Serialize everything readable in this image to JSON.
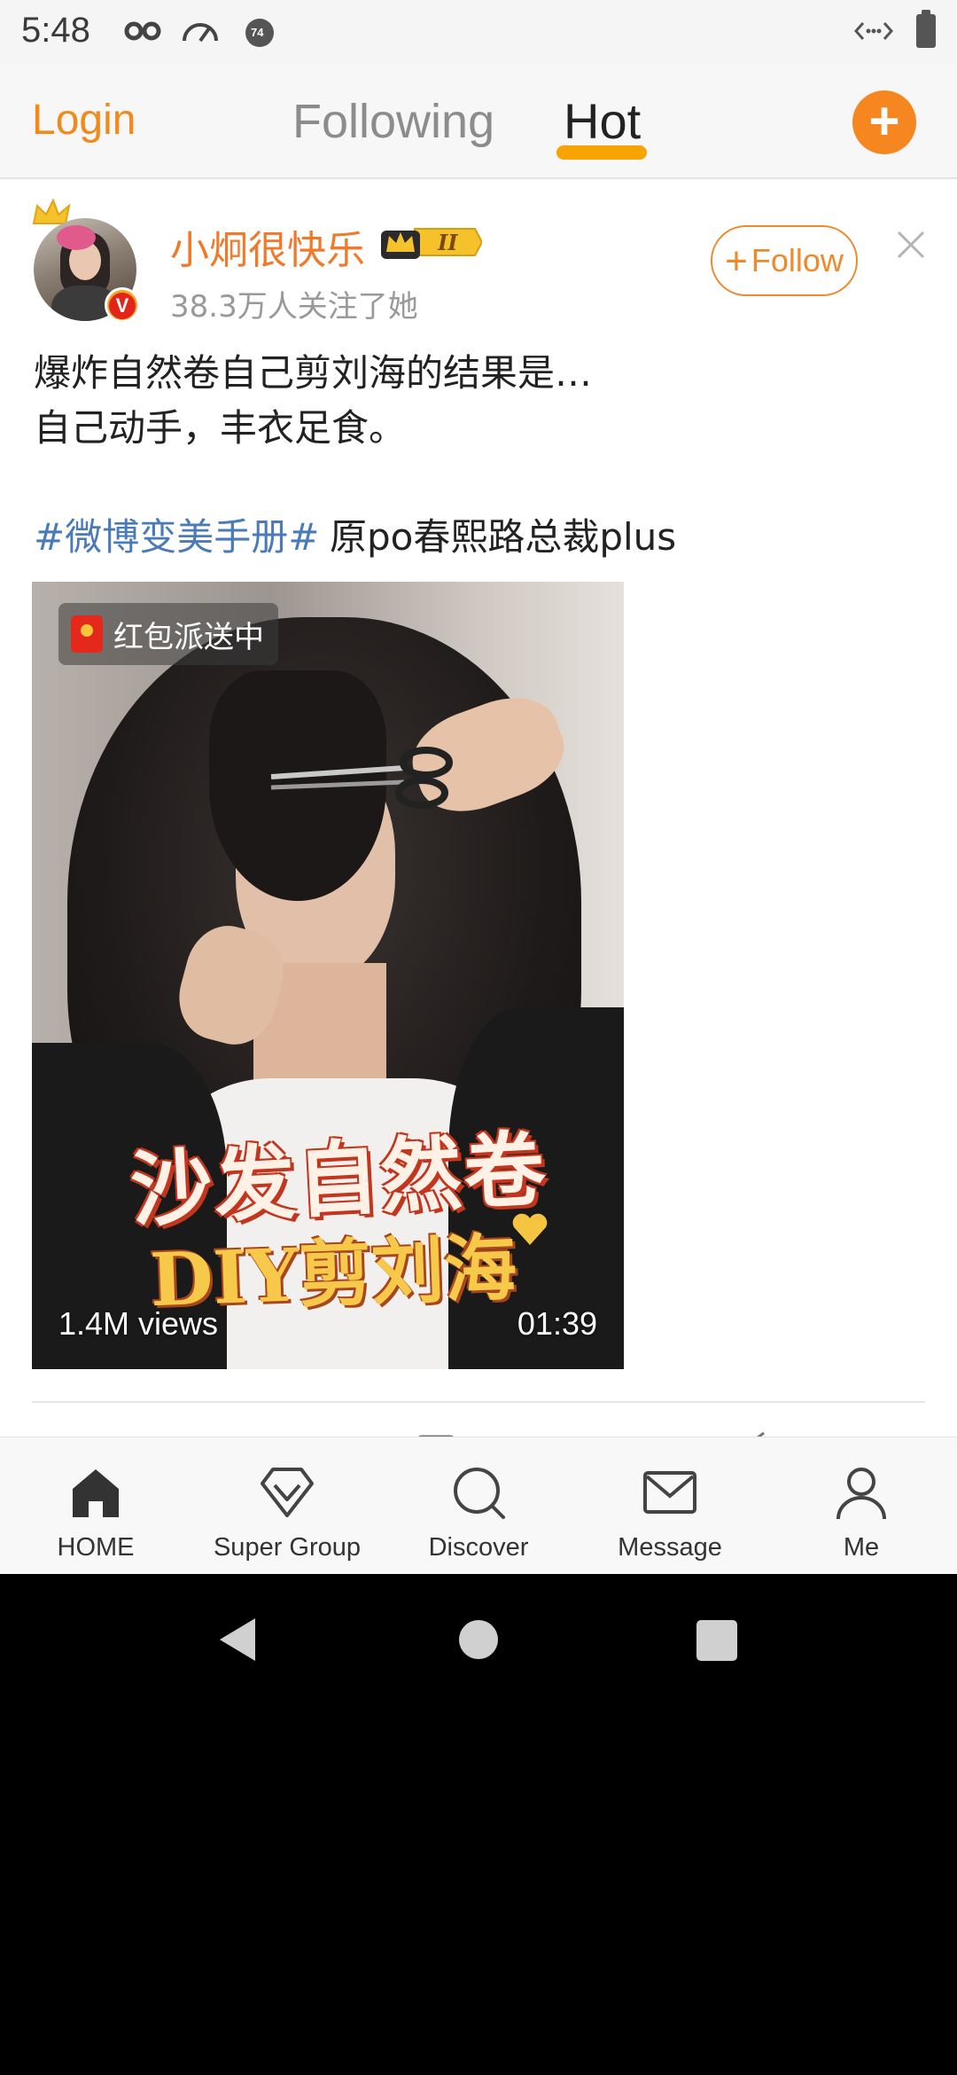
{
  "status_bar": {
    "time": "5:48",
    "icons": [
      "incognito-icon",
      "speedometer-icon",
      "notification-count-icon",
      "data-transfer-icon",
      "battery-icon"
    ],
    "notification_count": "74"
  },
  "top_nav": {
    "login": "Login",
    "tabs": [
      "Following",
      "Hot"
    ],
    "active_tab": "Hot",
    "accent": "#f28a1b"
  },
  "post": {
    "username": "小炯很快乐",
    "followers": "38.3万人关注了她",
    "follow_label": "Follow",
    "text_lines": [
      "爆炸自然卷自己剪刘海的结果是…",
      "自己动手，丰衣足食。"
    ],
    "topic": "#微博变美手册#",
    "after_topic": "原po春熙路总裁plus",
    "video": {
      "badge": "红包派送中",
      "views": "1.4M views",
      "duration": "01:39",
      "title": "沙发自然卷",
      "subtitle": "DIY剪刘海"
    }
  },
  "tab_bar": {
    "items": [
      "HOME",
      "Super Group",
      "Discover",
      "Message",
      "Me"
    ],
    "icons": [
      "home-icon",
      "diamond-icon",
      "search-icon",
      "mail-icon",
      "person-icon"
    ]
  },
  "colors": {
    "orange": "#f0792a",
    "topic_blue": "#4a7bb8",
    "underline": "#f7a400"
  }
}
